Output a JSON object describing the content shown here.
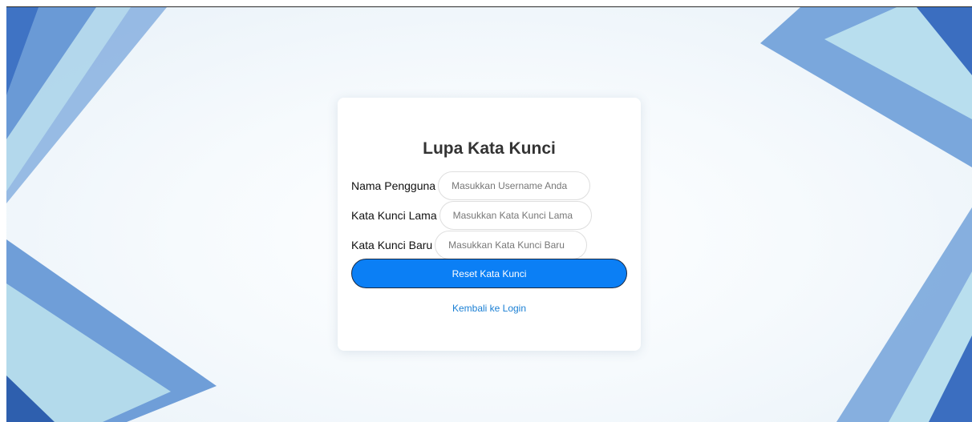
{
  "page": {
    "title": "Lupa Kata Kunci"
  },
  "form": {
    "fields": [
      {
        "label": "Nama Pengguna",
        "placeholder": "Masukkan Username Anda",
        "value": ""
      },
      {
        "label": "Kata Kunci Lama",
        "placeholder": "Masukkan Kata Kunci Lama",
        "value": ""
      },
      {
        "label": "Kata Kunci Baru",
        "placeholder": "Masukkan Kata Kunci Baru",
        "value": ""
      }
    ],
    "submit_label": "Reset Kata Kunci",
    "back_link_label": "Kembali ke Login"
  },
  "colors": {
    "accent": "#0b7ff5",
    "link": "#1a7fd4",
    "background_blue_dark": "#3f73c4",
    "background_blue_mid": "#7aa7dc",
    "background_blue_light": "#bfe4ef"
  }
}
